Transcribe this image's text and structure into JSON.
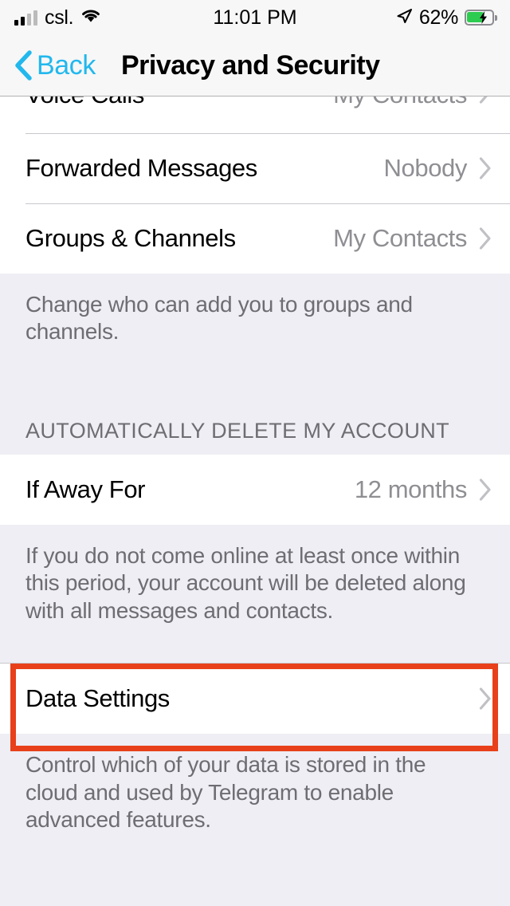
{
  "status_bar": {
    "carrier": "csl.",
    "time": "11:01 PM",
    "battery_percent": "62%",
    "signal_icon": "cellular-bars-icon",
    "wifi_icon": "wifi-icon",
    "location_icon": "location-arrow-icon",
    "battery_icon": "battery-charging-icon",
    "battery_fill_color": "#2DCB4F"
  },
  "nav": {
    "back_label": "Back",
    "back_icon": "chevron-left-icon",
    "title": "Privacy and Security",
    "accent_color": "#22B8ED"
  },
  "sections": [
    {
      "rows": [
        {
          "title": "Voice Calls",
          "value": "My Contacts",
          "clipped": true
        },
        {
          "title": "Forwarded Messages",
          "value": "Nobody",
          "clipped": false
        },
        {
          "title": "Groups & Channels",
          "value": "My Contacts",
          "clipped": false
        }
      ],
      "footer": "Change who can add you to groups and channels."
    }
  ],
  "auto_delete": {
    "header": "AUTOMATICALLY DELETE MY ACCOUNT",
    "row": {
      "title": "If Away For",
      "value": "12 months"
    },
    "footer": "If you do not come online at least once within this period, your account will be deleted along with all messages and contacts."
  },
  "data_settings": {
    "row": {
      "title": "Data Settings",
      "value": ""
    },
    "footer": "Control which of your data is stored in the cloud and used by Telegram to enable advanced features.",
    "highlight_color": "#E8401A"
  }
}
